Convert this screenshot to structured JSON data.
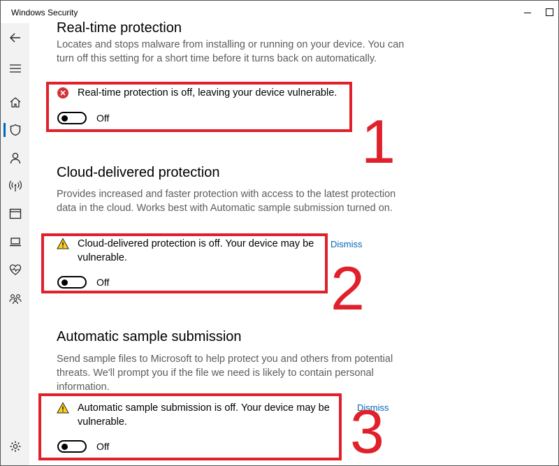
{
  "window": {
    "title": "Windows Security"
  },
  "sidebar": {
    "icons": [
      "back-arrow-icon",
      "hamburger-menu-icon",
      "home-icon",
      "shield-icon",
      "person-icon",
      "wireless-icon",
      "browser-window-icon",
      "laptop-icon",
      "heart-health-icon",
      "family-icon",
      "settings-gear-icon"
    ],
    "active": "shield-icon"
  },
  "sections": [
    {
      "title": "Real-time protection",
      "description": "Locates and stops malware from installing or running on your device. You can turn off this setting for a short time before it turns back on automatically.",
      "warning": "Real-time protection is off, leaving your device vulnerable.",
      "warning_type": "error",
      "toggle_label": "Off",
      "toggle_on": false,
      "annotation": "1"
    },
    {
      "title": "Cloud-delivered protection",
      "description": "Provides increased and faster protection with access to the latest protection data in the cloud. Works best with Automatic sample submission turned on.",
      "warning": "Cloud-delivered protection is off. Your device may be vulnerable.",
      "warning_type": "warning",
      "dismiss": "Dismiss",
      "toggle_label": "Off",
      "toggle_on": false,
      "annotation": "2"
    },
    {
      "title": "Automatic sample submission",
      "description": "Send sample files to Microsoft to help protect you and others from potential threats. We'll prompt you if the file we need is likely to contain personal information.",
      "warning": "Automatic sample submission is off. Your device may be vulnerable.",
      "warning_type": "warning",
      "dismiss": "Dismiss",
      "toggle_label": "Off",
      "toggle_on": false,
      "annotation": "3"
    }
  ],
  "colors": {
    "accent": "#0067b8",
    "annotation_red": "#e0202a",
    "error_red": "#d13438",
    "warning_yellow": "#fcd116"
  }
}
